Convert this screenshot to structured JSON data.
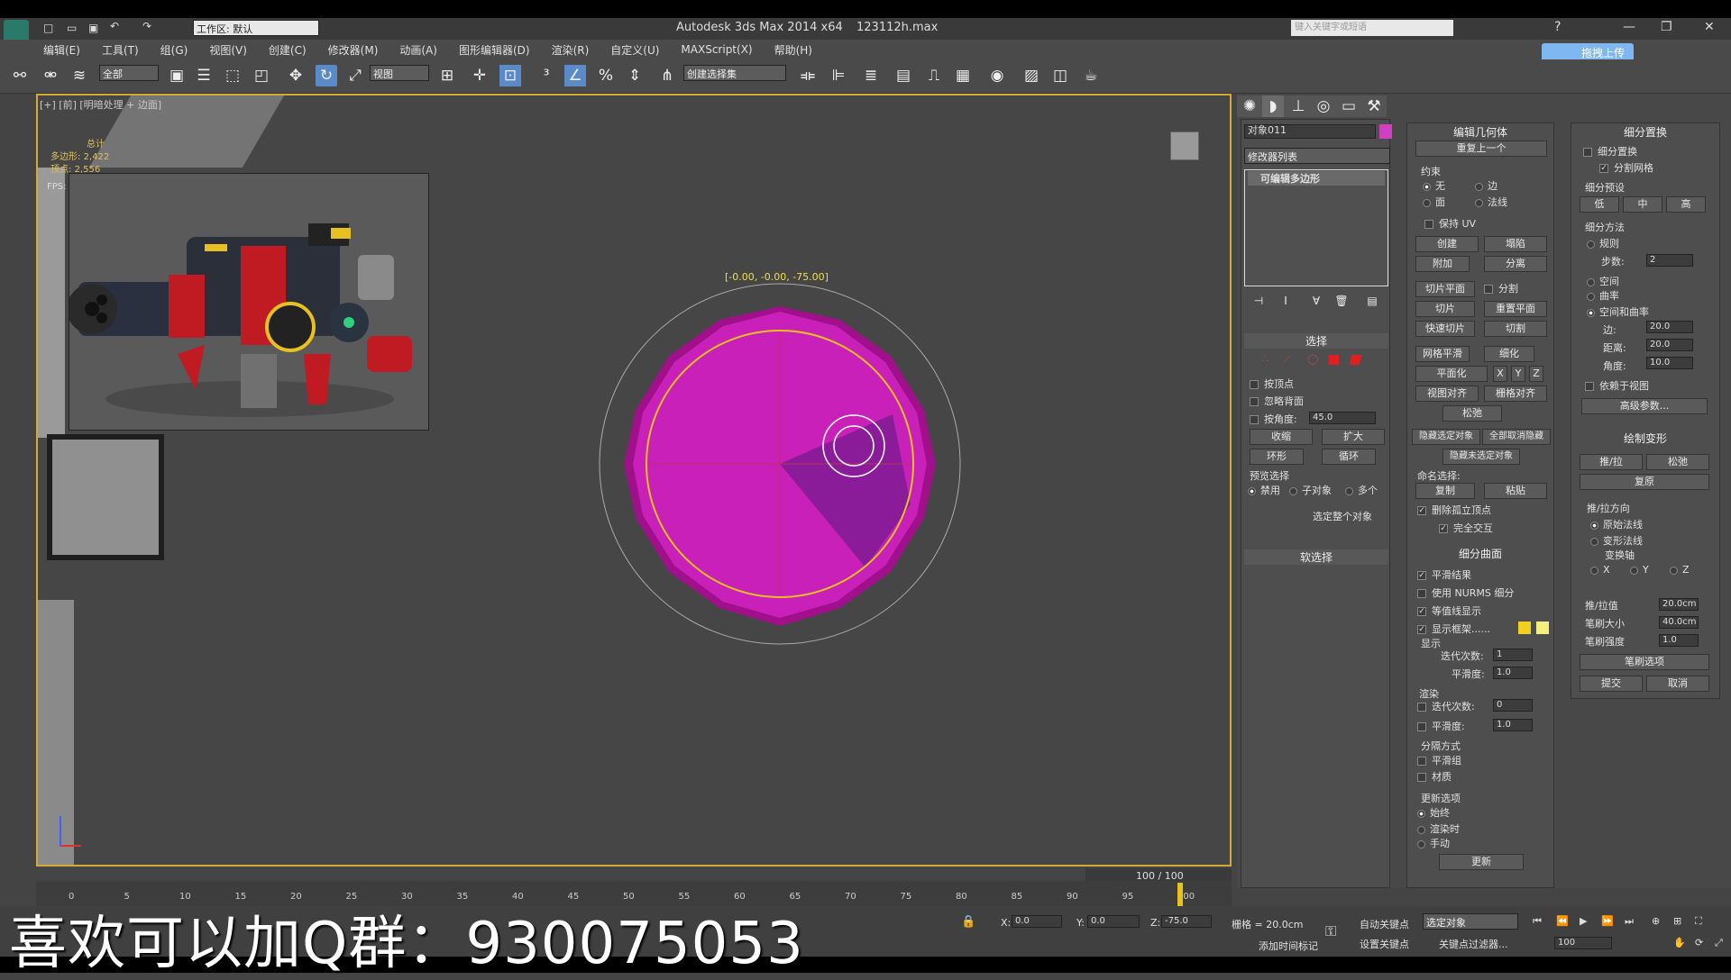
{
  "app": {
    "title": "Autodesk 3ds Max  2014 x64",
    "file": "123112h.max",
    "workspace": "工作区: 默认",
    "search_placeholder": "键入关键字或短语",
    "upload_label": "拖拽上传"
  },
  "menu": [
    "编辑(E)",
    "工具(T)",
    "组(G)",
    "视图(V)",
    "创建(C)",
    "修改器(M)",
    "动画(A)",
    "图形编辑器(D)",
    "渲染(R)",
    "自定义(U)",
    "MAXScript(X)",
    "帮助(H)"
  ],
  "toolbar": {
    "filter_value": "全部",
    "ref_coord_value": "视图",
    "selection_set_value": "创建选择集"
  },
  "viewport": {
    "label": "[+] [前] [明暗处理 + 边面]",
    "stats": {
      "total": "总计",
      "polys_label": "多边形:",
      "polys": "2,422",
      "verts_label": "顶点:",
      "verts": "2,556"
    },
    "fps": "FPS:",
    "coord_readout": "[-0.00, -0.00, -75.00]"
  },
  "modify_panel": {
    "object_name": "对象011",
    "object_color": "#d040c0",
    "modifier_list": "修改器列表",
    "stack_item": "可编辑多边形",
    "select_rollout": {
      "title": "选择",
      "by_vertex": "按顶点",
      "ignore_backface": "忽略背面",
      "by_angle": "按角度:",
      "angle_value": "45.0",
      "shrink": "收缩",
      "grow": "扩大",
      "ring": "环形",
      "loop": "循环",
      "preview_title": "预览选择",
      "preview_off": "禁用",
      "preview_sub": "子对象",
      "preview_multi": "多个",
      "select_whole": "选定整个对象"
    },
    "soft_select": "软选择"
  },
  "edit_geometry": {
    "title": "编辑几何体",
    "repeat_last": "重复上一个",
    "constraints_title": "约束",
    "c_none": "无",
    "c_edge": "边",
    "c_face": "面",
    "c_normal": "法线",
    "preserve_uv": "保持 UV",
    "create": "创建",
    "collapse": "塌陷",
    "attach": "附加",
    "detach": "分离",
    "slice_plane": "切片平面",
    "split": "分割",
    "slice": "切片",
    "reset_plane": "重置平面",
    "quickslice": "快速切片",
    "cut": "切割",
    "meshsmooth": "网格平滑",
    "tessellate": "细化",
    "make_planar": "平面化",
    "x": "X",
    "y": "Y",
    "z": "Z",
    "view_align": "视图对齐",
    "grid_align": "栅格对齐",
    "relax": "松弛",
    "hide_selected": "隐藏选定对象",
    "unhide_all": "全部取消隐藏",
    "hide_unselected": "隐藏未选定对象",
    "named_sel": "命名选择:",
    "copy": "复制",
    "paste": "粘贴",
    "delete_iso": "删除孤立顶点",
    "full_interact": "完全交互"
  },
  "subdivision_surface": {
    "title": "细分曲面",
    "smooth_result": "平滑结果",
    "use_nurms": "使用 NURMS 细分",
    "isoline": "等值线显示",
    "show_cage": "显示框架......",
    "cage_color1": "#f0d020",
    "cage_color2": "#f4f080",
    "display": "显示",
    "iterations": "迭代次数:",
    "iter_value": "1",
    "smoothness": "平滑度:",
    "smooth_value": "1.0",
    "render": "渲染",
    "r_iter_value": "0",
    "r_smooth_value": "1.0",
    "sep_by": "分隔方式",
    "smoothing_groups": "平滑组",
    "materials": "材质",
    "update_opts": "更新选项",
    "always": "始终",
    "when_render": "渲染时",
    "manual": "手动",
    "update": "更新"
  },
  "subdivision_displacement": {
    "title": "细分置换",
    "subdiv_disp": "细分置换",
    "split_mesh": "分割网格",
    "presets": "细分预设",
    "low": "低",
    "mid": "中",
    "high": "高",
    "method": "细分方法",
    "regular": "规则",
    "steps": "步数:",
    "steps_value": "2",
    "spatial": "空间",
    "curvature": "曲率",
    "spatial_curv": "空间和曲率",
    "edge": "边:",
    "edge_value": "20.0",
    "distance": "距离:",
    "dist_value": "20.0",
    "angle": "角度:",
    "angle_value": "10.0",
    "view_dep": "依赖于视图",
    "advanced": "高级参数..."
  },
  "paint_deform": {
    "title": "绘制变形",
    "push_pull": "推/拉",
    "relax": "松弛",
    "revert": "复原",
    "direction": "推/拉方向",
    "orig_normals": "原始法线",
    "deformed_normals": "变形法线",
    "transform_axis": "变换轴",
    "ax_x": "X",
    "ax_y": "Y",
    "ax_z": "Z",
    "push_value_label": "推/拉值",
    "push_value": "20.0cm",
    "brush_size_label": "笔刷大小",
    "brush_size": "40.0cm",
    "brush_strength_label": "笔刷强度",
    "brush_strength": "1.0",
    "brush_options": "笔刷选项",
    "commit": "提交",
    "cancel": "取消"
  },
  "timeline": {
    "frame_counter": "100 / 100",
    "ticks": [
      "0",
      "5",
      "10",
      "15",
      "20",
      "25",
      "30",
      "35",
      "40",
      "45",
      "50",
      "55",
      "60",
      "65",
      "70",
      "75",
      "80",
      "85",
      "90",
      "95",
      "100"
    ]
  },
  "status": {
    "x_label": "X:",
    "x_value": "0.0",
    "y_label": "Y:",
    "y_value": "0.0",
    "z_label": "Z:",
    "z_value": "-75.0",
    "grid": "栅格 = 20.0cm",
    "auto_key": "自动关键点",
    "selected_set": "选定对象",
    "set_key": "设置关键点",
    "key_filters": "关键点过滤器...",
    "add_time_tag": "添加时间标记",
    "frame_value": "100"
  },
  "watermark": "喜欢可以加Q群：930075053"
}
